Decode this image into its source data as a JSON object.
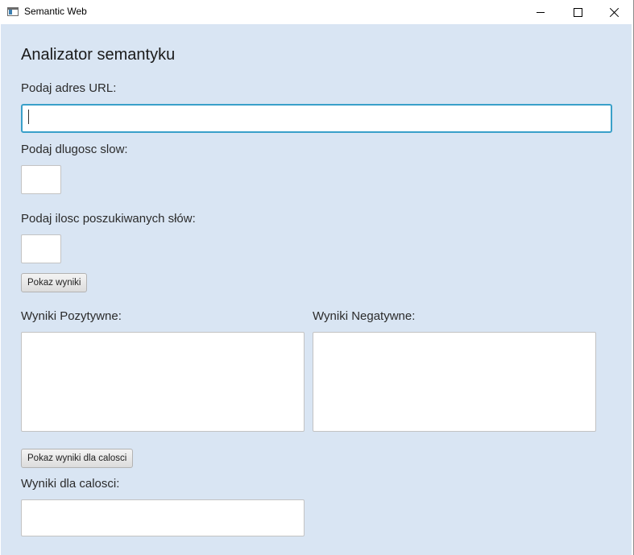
{
  "window": {
    "title": "Semantic Web",
    "icon": "app-window-icon",
    "controls": [
      "minimize-icon",
      "maximize-icon",
      "close-icon"
    ]
  },
  "form": {
    "heading": "Analizator semantyku",
    "url_label": "Podaj adres URL:",
    "url_value": "",
    "length_label": "Podaj dlugosc slow:",
    "length_value": "",
    "count_label": "Podaj ilosc poszukiwanych słów:",
    "count_value": "",
    "show_results_button": "Pokaz wyniki",
    "positive_label": "Wyniki Pozytywne:",
    "positive_value": "",
    "negative_label": "Wyniki Negatywne:",
    "negative_value": "",
    "show_total_button": "Pokaz wyniki dla calosci",
    "total_label": "Wyniki dla calosci:",
    "total_value": ""
  },
  "colors": {
    "background": "#d9e5f3",
    "focus_border": "#3aa0c9"
  }
}
